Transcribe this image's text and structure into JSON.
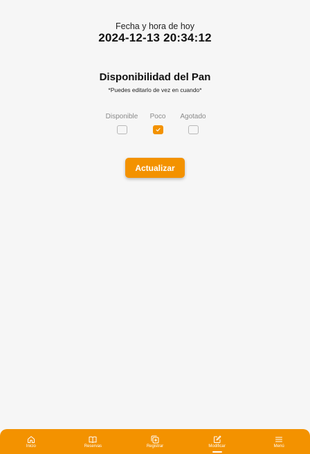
{
  "header": {
    "datetime_label": "Fecha y hora de hoy",
    "datetime_value": "2024-12-13 20:34:12"
  },
  "availability": {
    "title": "Disponibilidad del Pan",
    "note": "*Puedes editarlo de vez en cuando*",
    "options": [
      {
        "label": "Disponible",
        "checked": false
      },
      {
        "label": "Poco",
        "checked": true
      },
      {
        "label": "Agotado",
        "checked": false
      }
    ],
    "update_label": "Actualizar"
  },
  "bottom_nav": {
    "items": [
      {
        "label": "Inicio",
        "icon": "home-icon"
      },
      {
        "label": "Reservas",
        "icon": "book-icon"
      },
      {
        "label": "Registrar",
        "icon": "add-box-icon"
      },
      {
        "label": "Modificar",
        "icon": "edit-icon",
        "active": true
      },
      {
        "label": "Menú",
        "icon": "menu-icon"
      }
    ]
  },
  "colors": {
    "accent": "#f39200",
    "background": "#f6f6f6"
  }
}
